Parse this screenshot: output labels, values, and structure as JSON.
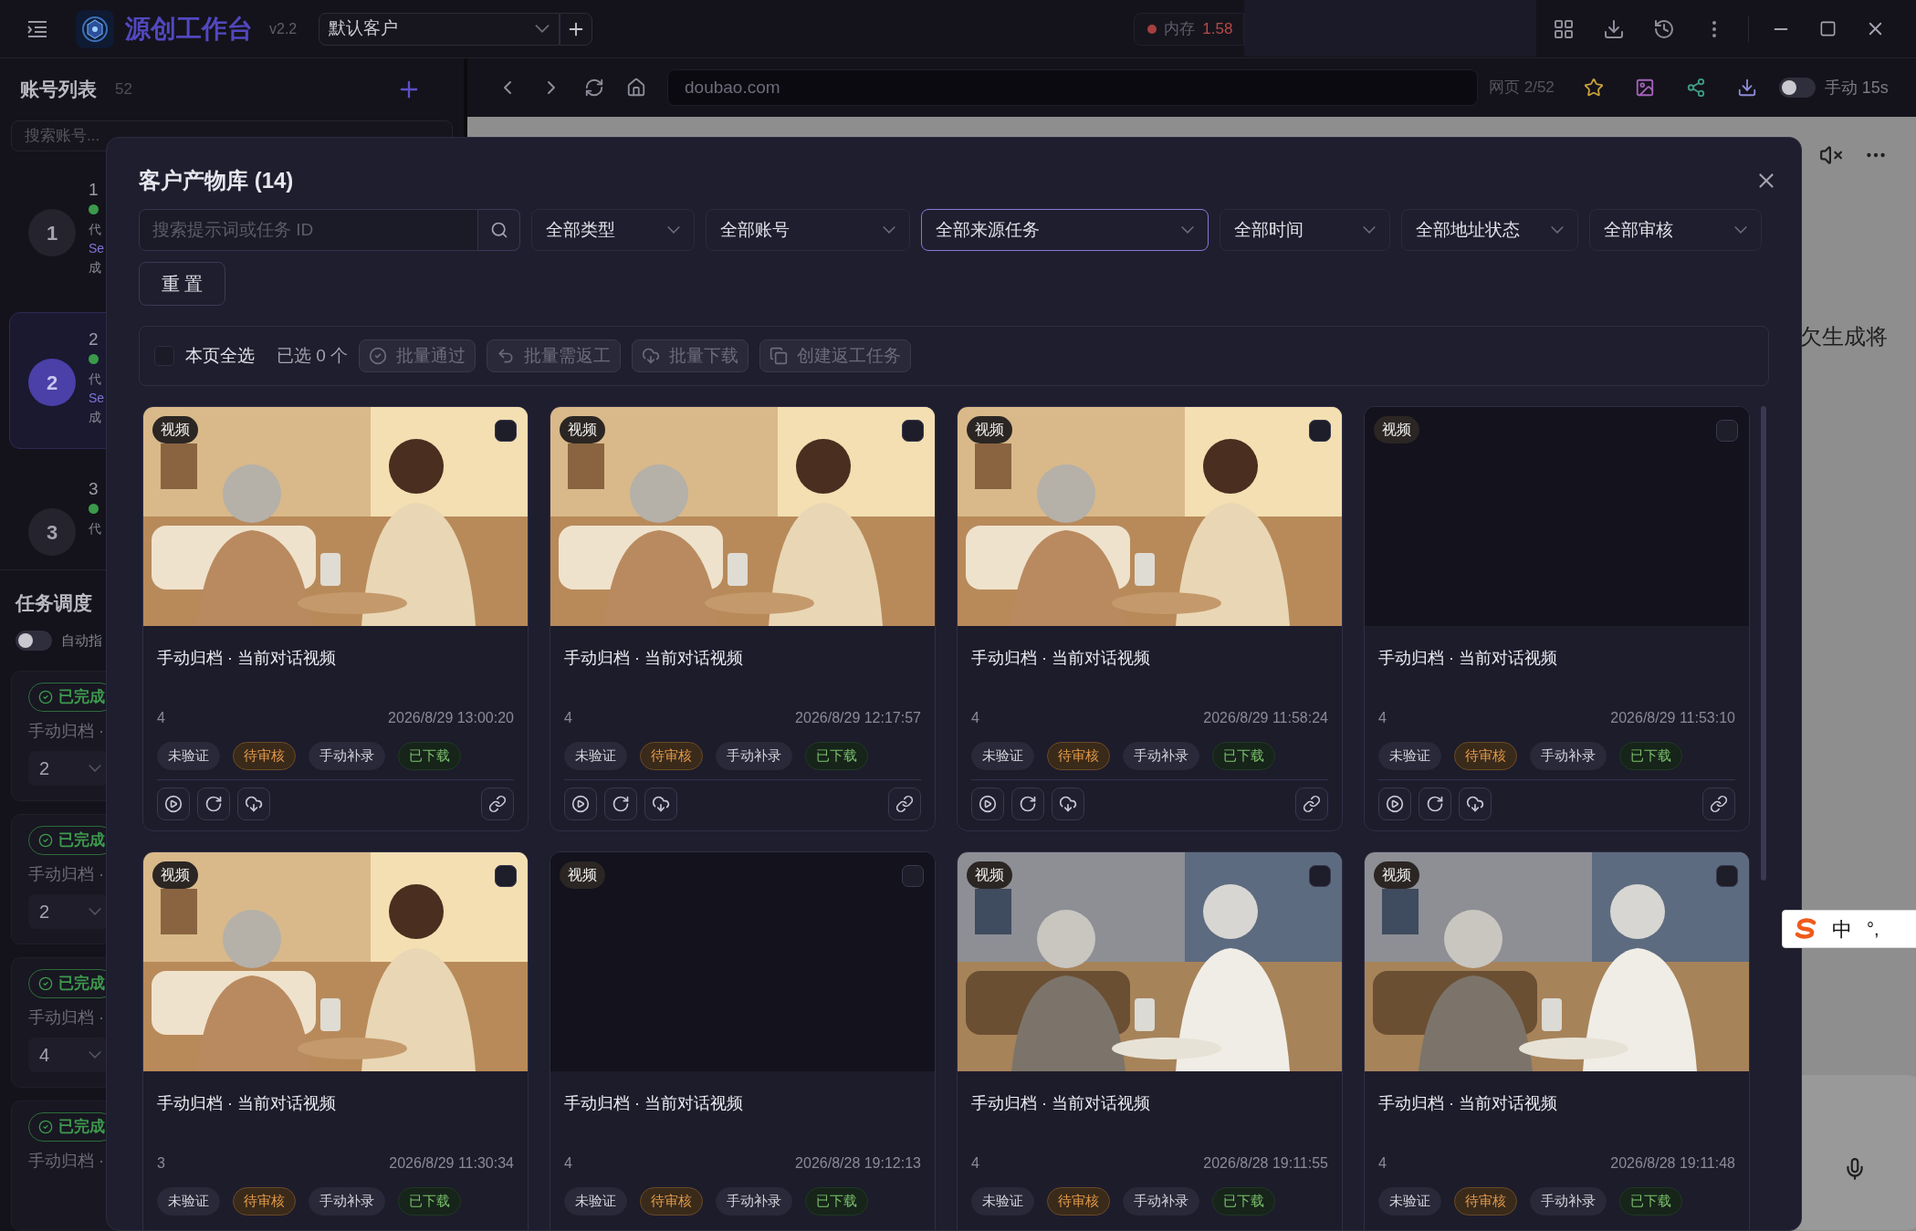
{
  "app": {
    "title": "源创工作台",
    "version": "v2.2",
    "customer_select": "默认客户",
    "memory": {
      "label": "内存",
      "value": "1.58"
    }
  },
  "browser": {
    "url": "doubao.com",
    "page_counter": "网页 2/52",
    "auto_toggle": {
      "on": false,
      "label": "手动 15s"
    }
  },
  "sidebar": {
    "title": "账号列表",
    "count": "52",
    "search_placeholder": "搜索账号...",
    "accounts": [
      {
        "number": "1",
        "selected": false,
        "name": "1",
        "online": true,
        "details": [
          "代",
          "Se",
          "成"
        ]
      },
      {
        "number": "2",
        "selected": true,
        "name": "2",
        "online": true,
        "details": [
          "代",
          "Se",
          "成"
        ]
      },
      {
        "number": "3",
        "selected": false,
        "name": "3",
        "online": true,
        "details": [
          "代"
        ]
      }
    ],
    "task_section": {
      "title": "任务调度",
      "auto_toggle": {
        "on": false,
        "label": "自动指"
      },
      "tasks": [
        {
          "status": "已完成",
          "name": "手动归档 ·",
          "value": "2"
        },
        {
          "status": "已完成",
          "name": "手动归档 ·",
          "value": "2"
        },
        {
          "status": "已完成",
          "name": "手动归档 ·",
          "value": "4"
        },
        {
          "status": "已完成",
          "name": "手动归档 ·"
        }
      ]
    }
  },
  "page_snippet": "欠生成将",
  "modal": {
    "title": "客户产物库 (14)",
    "search_placeholder": "搜索提示词或任务 ID",
    "filters": [
      {
        "label": "全部类型",
        "selected": false
      },
      {
        "label": "全部账号",
        "selected": false
      },
      {
        "label": "全部来源任务",
        "selected": true
      },
      {
        "label": "全部时间",
        "selected": false
      },
      {
        "label": "全部地址状态",
        "selected": false
      },
      {
        "label": "全部审核",
        "selected": false
      }
    ],
    "reset": "重 置",
    "bulk": {
      "select_all": {
        "label": "本页全选",
        "checked": false
      },
      "selected_count": "已选 0 个",
      "actions": [
        {
          "label": "批量通过",
          "disabled": true
        },
        {
          "label": "批量需返工",
          "disabled": true
        },
        {
          "label": "批量下载",
          "disabled": true
        },
        {
          "label": "创建返工任务",
          "disabled": true
        }
      ]
    },
    "cards": [
      {
        "type_tag": "视频",
        "kind": "picture",
        "checked": false,
        "title": "手动归档 · 当前对话视频",
        "count": "4",
        "time": "2026/8/29 13:00:20",
        "badges": [
          {
            "text": "未验证",
            "kind": "neutral"
          },
          {
            "text": "待审核",
            "kind": "pending"
          },
          {
            "text": "手动补录",
            "kind": "neutral"
          },
          {
            "text": "已下载",
            "kind": "done"
          }
        ]
      },
      {
        "type_tag": "视频",
        "kind": "picture",
        "checked": false,
        "title": "手动归档 · 当前对话视频",
        "count": "4",
        "time": "2026/8/29 12:17:57",
        "badges": [
          {
            "text": "未验证",
            "kind": "neutral"
          },
          {
            "text": "待审核",
            "kind": "pending"
          },
          {
            "text": "手动补录",
            "kind": "neutral"
          },
          {
            "text": "已下载",
            "kind": "done"
          }
        ]
      },
      {
        "type_tag": "视频",
        "kind": "picture",
        "checked": false,
        "title": "手动归档 · 当前对话视频",
        "count": "4",
        "time": "2026/8/29 11:58:24",
        "badges": [
          {
            "text": "未验证",
            "kind": "neutral"
          },
          {
            "text": "待审核",
            "kind": "pending"
          },
          {
            "text": "手动补录",
            "kind": "neutral"
          },
          {
            "text": "已下载",
            "kind": "done"
          }
        ]
      },
      {
        "type_tag": "视频",
        "kind": "empty",
        "checked": false,
        "title": "手动归档 · 当前对话视频",
        "count": "4",
        "time": "2026/8/29 11:53:10",
        "badges": [
          {
            "text": "未验证",
            "kind": "neutral"
          },
          {
            "text": "待审核",
            "kind": "pending"
          },
          {
            "text": "手动补录",
            "kind": "neutral"
          },
          {
            "text": "已下载",
            "kind": "done"
          }
        ]
      },
      {
        "type_tag": "视频",
        "kind": "picture",
        "checked": false,
        "title": "手动归档 · 当前对话视频",
        "count": "3",
        "time": "2026/8/29 11:30:34",
        "badges": [
          {
            "text": "未验证",
            "kind": "neutral"
          },
          {
            "text": "待审核",
            "kind": "pending"
          },
          {
            "text": "手动补录",
            "kind": "neutral"
          },
          {
            "text": "已下载",
            "kind": "done"
          }
        ]
      },
      {
        "type_tag": "视频",
        "kind": "empty",
        "checked": false,
        "title": "手动归档 · 当前对话视频",
        "count": "4",
        "time": "2026/8/28 19:12:13",
        "badges": [
          {
            "text": "未验证",
            "kind": "neutral"
          },
          {
            "text": "待审核",
            "kind": "pending"
          },
          {
            "text": "手动补录",
            "kind": "neutral"
          },
          {
            "text": "已下载",
            "kind": "done"
          }
        ]
      },
      {
        "type_tag": "视频",
        "kind": "picture",
        "checked": false,
        "title": "手动归档 · 当前对话视频",
        "count": "4",
        "time": "2026/8/28 19:11:55",
        "badges": [
          {
            "text": "未验证",
            "kind": "neutral"
          },
          {
            "text": "待审核",
            "kind": "pending"
          },
          {
            "text": "手动补录",
            "kind": "neutral"
          },
          {
            "text": "已下载",
            "kind": "done"
          }
        ]
      },
      {
        "type_tag": "视频",
        "kind": "picture",
        "checked": false,
        "title": "手动归档 · 当前对话视频",
        "count": "4",
        "time": "2026/8/28 19:11:48",
        "badges": [
          {
            "text": "未验证",
            "kind": "neutral"
          },
          {
            "text": "待审核",
            "kind": "pending"
          },
          {
            "text": "手动补录",
            "kind": "neutral"
          },
          {
            "text": "已下载",
            "kind": "done"
          }
        ]
      }
    ]
  },
  "ime": {
    "mode": "中",
    "punct": "°,"
  }
}
